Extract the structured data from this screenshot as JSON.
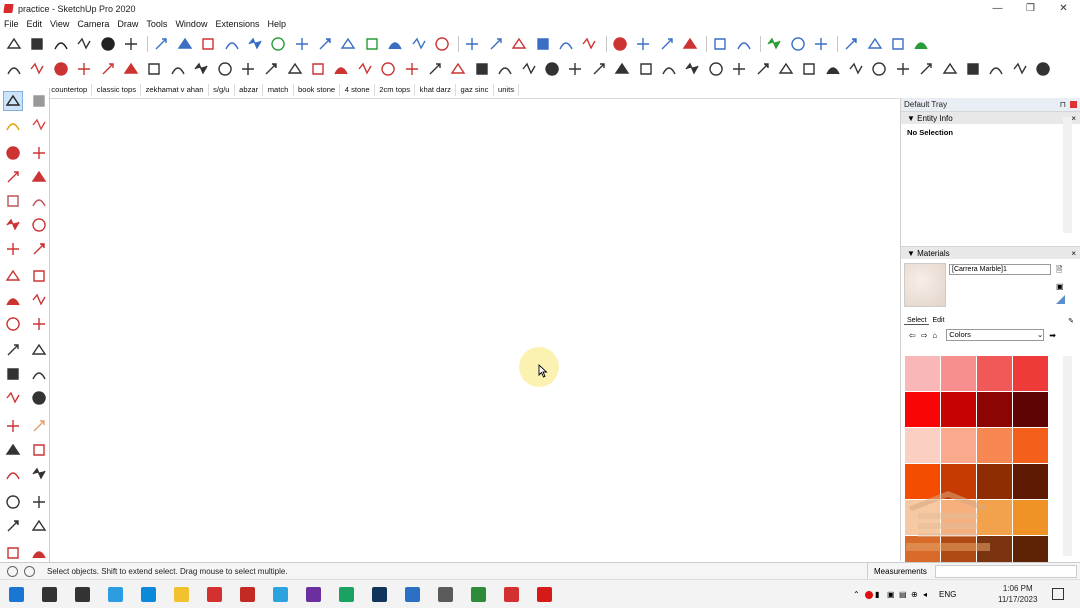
{
  "window": {
    "title": "practice - SketchUp Pro 2020",
    "minimize": "—",
    "maximize": "❐",
    "close": "✕"
  },
  "menu": [
    "File",
    "Edit",
    "View",
    "Camera",
    "Draw",
    "Tools",
    "Window",
    "Extensions",
    "Help"
  ],
  "tags": [
    "countertop",
    "classic tops",
    "zekhamat v ahan",
    "s/g/u",
    "abzar",
    "match",
    "book stone",
    "4 stone",
    "2cm tops",
    "khat darz",
    "gaz sinc",
    "units"
  ],
  "tray": {
    "title": "Default Tray",
    "entity_info": {
      "header": "Entity Info",
      "content": "No Selection"
    },
    "materials": {
      "header": "Materials",
      "name_value": "[Carrera Marble]1",
      "tabs": [
        "Select",
        "Edit"
      ],
      "collection": "Colors",
      "swatches": [
        "#f9b7b7",
        "#f78f8f",
        "#f15858",
        "#ef3a3a",
        "#fa0505",
        "#c60202",
        "#8d0404",
        "#5e0404",
        "#fbd0c2",
        "#f9a98c",
        "#f68652",
        "#f55f1c",
        "#f44d02",
        "#c63b02",
        "#8e2c02",
        "#5e1a02",
        "#f7c9a2",
        "#f5b07d",
        "#f2a24a",
        "#ef9326",
        "#d86a2a",
        "#b04a14",
        "#7a3410",
        "#5d2304"
      ]
    }
  },
  "status": {
    "message": "Select objects. Shift to extend select. Drag mouse to select multiple.",
    "measurements_label": "Measurements"
  },
  "taskbar": {
    "apps": [
      {
        "name": "start",
        "color": "#1976d2"
      },
      {
        "name": "search",
        "color": "#333333"
      },
      {
        "name": "task-view",
        "color": "#333333"
      },
      {
        "name": "app-3",
        "color": "#2b9de0"
      },
      {
        "name": "edge",
        "color": "#0c8ad9"
      },
      {
        "name": "explorer",
        "color": "#f2c12e"
      },
      {
        "name": "sketchup",
        "color": "#d3312f"
      },
      {
        "name": "acrobat",
        "color": "#c42a24"
      },
      {
        "name": "telegram",
        "color": "#2aa3de"
      },
      {
        "name": "vs",
        "color": "#6b2fa0"
      },
      {
        "name": "chrome",
        "color": "#1aa260"
      },
      {
        "name": "photoshop",
        "color": "#11345a"
      },
      {
        "name": "app-shield",
        "color": "#2a6fc4"
      },
      {
        "name": "app-store",
        "color": "#5a5a5a"
      },
      {
        "name": "app-globe",
        "color": "#2e8b3a"
      },
      {
        "name": "sketchup-2",
        "color": "#d3312f"
      },
      {
        "name": "recorder",
        "color": "#d61a1a"
      }
    ],
    "lang": "ENG",
    "time": "1:06 PM",
    "date": "11/17/2023"
  }
}
